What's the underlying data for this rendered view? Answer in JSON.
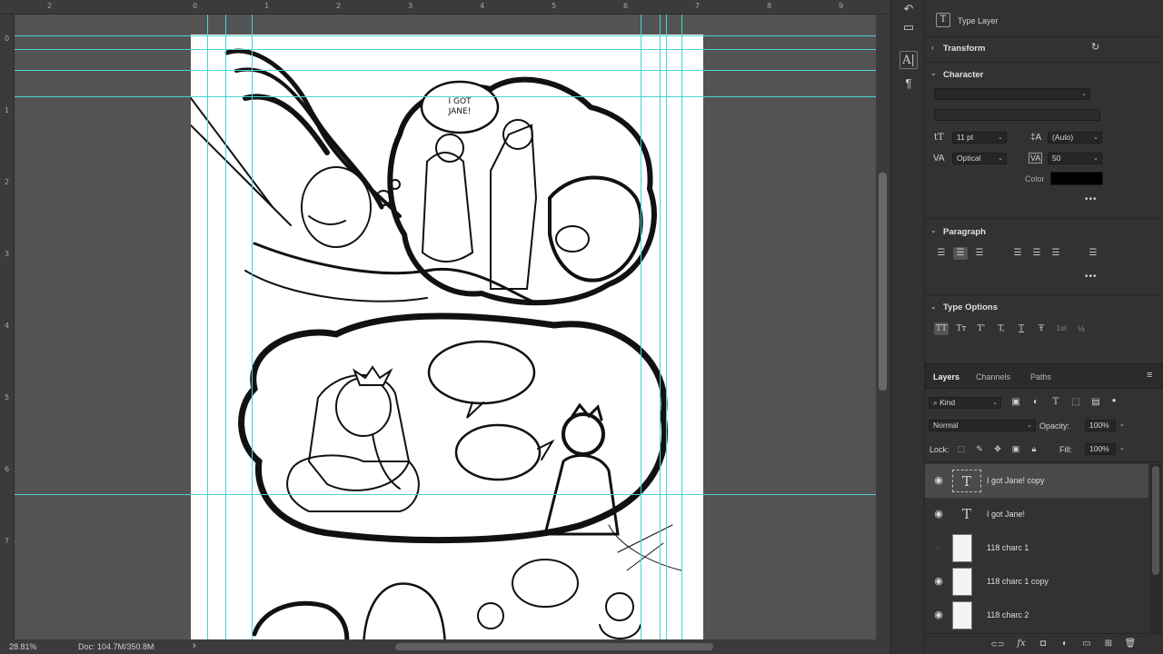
{
  "rulers": {
    "top": [
      "2",
      "0",
      "1",
      "2",
      "3",
      "4",
      "5",
      "6",
      "7",
      "8",
      "9"
    ],
    "left": [
      "0",
      "1",
      "2",
      "3",
      "4",
      "5",
      "6",
      "7"
    ]
  },
  "status": {
    "zoom": "28.81%",
    "doc": "Doc: 104.7M/350.8M",
    "arrow": "›"
  },
  "properties": {
    "layer_kind": "Type Layer",
    "transform_label": "Transform",
    "character_label": "Character",
    "font_size": "11 pt",
    "leading": "(Auto)",
    "kerning": "Optical",
    "tracking": "50",
    "color_label": "Color",
    "color_value": "#000000",
    "paragraph_label": "Paragraph",
    "type_options_label": "Type Options",
    "type_options_glyphs": [
      "TT",
      "Tт",
      "T'",
      "T,",
      "T",
      "Ŧ",
      "1st",
      "½"
    ]
  },
  "layers_panel": {
    "tabs": [
      "Layers",
      "Channels",
      "Paths"
    ],
    "filter": "Kind",
    "blend_mode": "Normal",
    "opacity_label": "Opacity:",
    "opacity": "100%",
    "lock_label": "Lock:",
    "fill_label": "Fill:",
    "fill": "100%",
    "layers": [
      {
        "name": "I got  Jane! copy",
        "type": "text",
        "visible": true,
        "selected": true
      },
      {
        "name": "I got  Jane!",
        "type": "text",
        "visible": true,
        "selected": false
      },
      {
        "name": "118 charc 1",
        "type": "image",
        "visible": false,
        "selected": false
      },
      {
        "name": "118 charc 1 copy",
        "type": "image",
        "visible": true,
        "selected": false
      },
      {
        "name": "118 charc 2",
        "type": "image",
        "visible": true,
        "selected": false
      }
    ]
  },
  "artwork": {
    "speech_bubble": "I GOT\nJANE!"
  },
  "colors": {
    "guide": "#49d3d3",
    "panel": "#323232",
    "canvas_bg": "#535353"
  }
}
